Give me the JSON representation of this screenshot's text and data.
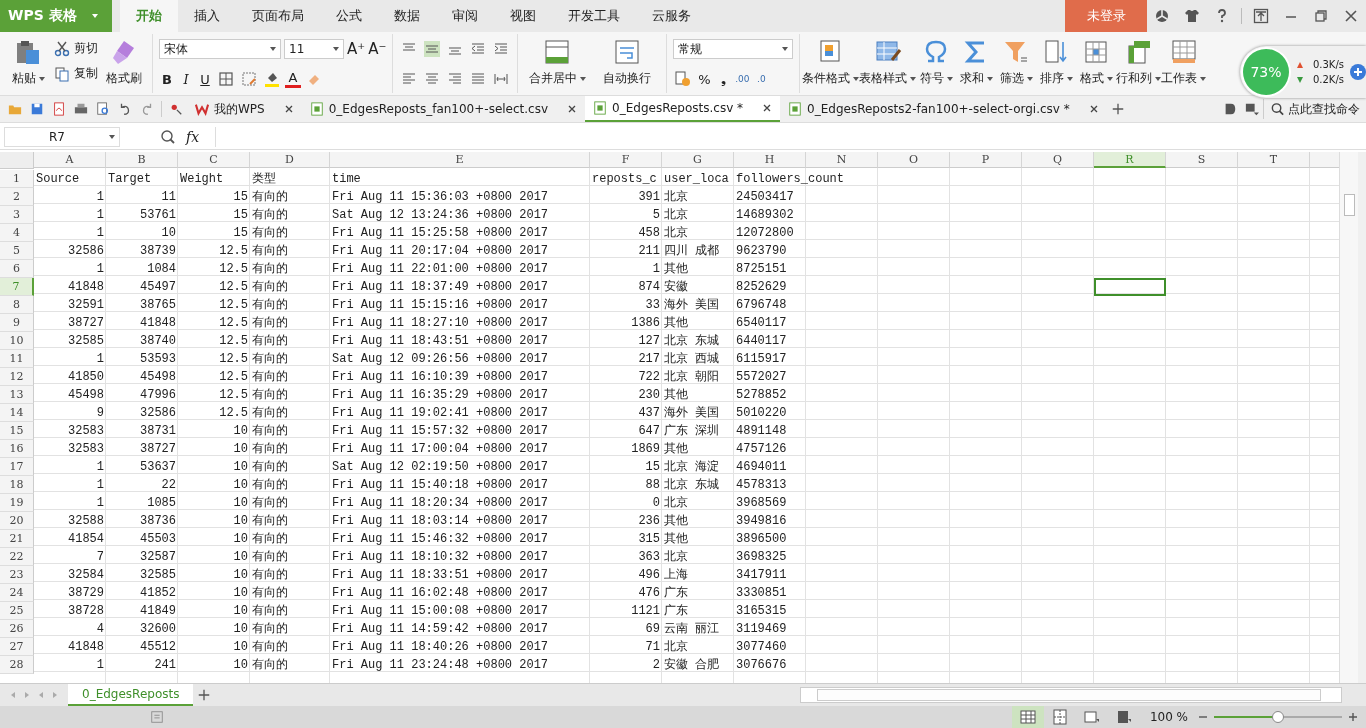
{
  "title_bar": {
    "app_button": "WPS 表格",
    "menu_tabs": [
      {
        "label": "开始",
        "selected": true
      },
      {
        "label": "插入",
        "selected": false
      },
      {
        "label": "页面布局",
        "selected": false
      },
      {
        "label": "公式",
        "selected": false
      },
      {
        "label": "数据",
        "selected": false
      },
      {
        "label": "审阅",
        "selected": false
      },
      {
        "label": "视图",
        "selected": false
      },
      {
        "label": "开发工具",
        "selected": false
      },
      {
        "label": "云服务",
        "selected": false
      }
    ],
    "login": "未登录"
  },
  "ribbon": {
    "paste": "粘贴",
    "cut": "剪切",
    "copy": "复制",
    "format_painter": "格式刷",
    "font": "宋体",
    "font_size": "11",
    "size_buttons": [
      "A⁺",
      "A⁻"
    ],
    "style_buttons": [
      "B",
      "I",
      "U"
    ],
    "font_color": "A",
    "merge": "合并居中",
    "wrap": "自动换行",
    "number_format": "常规",
    "percent": "%",
    "comma": "❟",
    "decimals": [
      ".00",
      ".0"
    ],
    "big_buttons": [
      {
        "label": "条件格式",
        "kind": "condition"
      },
      {
        "label": "表格样式",
        "kind": "style"
      },
      {
        "label": "符号",
        "kind": "omega"
      },
      {
        "label": "求和",
        "kind": "sigma"
      },
      {
        "label": "筛选",
        "kind": "filter"
      },
      {
        "label": "排序",
        "kind": "sort"
      },
      {
        "label": "格式",
        "kind": "format"
      },
      {
        "label": "行和列",
        "kind": "rowcol"
      },
      {
        "label": "工作表",
        "kind": "sheet"
      }
    ]
  },
  "network_widget": {
    "percent": "73%",
    "upload": "0.3K/s",
    "download": "0.2K/s"
  },
  "doc_tabs": [
    {
      "label": "我的WPS",
      "kind": "home",
      "selected": false
    },
    {
      "label": "0_EdgesReposts_fan100+-select.csv",
      "kind": "file",
      "selected": false
    },
    {
      "label": "0_EdgesReposts.csv *",
      "kind": "file",
      "selected": true
    },
    {
      "label": "0_EdgesReposts2-fan100+-select-orgi.csv *",
      "kind": "file",
      "selected": false
    }
  ],
  "command_search": {
    "placeholder": "点此查找命令"
  },
  "formula_bar": {
    "name_box": "R7",
    "fx": "fx"
  },
  "sheet": {
    "columns": [
      {
        "letter": "A",
        "selected": false
      },
      {
        "letter": "B",
        "selected": false
      },
      {
        "letter": "C",
        "selected": false
      },
      {
        "letter": "D",
        "selected": false
      },
      {
        "letter": "E",
        "selected": false
      },
      {
        "letter": "F",
        "selected": false
      },
      {
        "letter": "G",
        "selected": false
      },
      {
        "letter": "H",
        "selected": false
      },
      {
        "letter": "N",
        "selected": false
      },
      {
        "letter": "O",
        "selected": false
      },
      {
        "letter": "P",
        "selected": false
      },
      {
        "letter": "Q",
        "selected": false
      },
      {
        "letter": "R",
        "selected": true
      },
      {
        "letter": "S",
        "selected": false
      },
      {
        "letter": "T",
        "selected": false
      }
    ],
    "rows": [
      {
        "number": "1",
        "kind": "header",
        "selected": false,
        "cells": [
          "Source",
          "Target",
          "Weight",
          "类型",
          "time",
          "reposts_c",
          "user_loca",
          "followers_count"
        ]
      },
      {
        "number": "2",
        "kind": "data",
        "selected": false,
        "cells": [
          "1",
          "11",
          "15",
          "有向的",
          "Fri Aug 11 15:36:03 +0800 2017",
          "391",
          "北京",
          "24503417"
        ]
      },
      {
        "number": "3",
        "kind": "data",
        "selected": false,
        "cells": [
          "1",
          "53761",
          "15",
          "有向的",
          "Sat Aug 12 13:24:36 +0800 2017",
          "5",
          "北京",
          "14689302"
        ]
      },
      {
        "number": "4",
        "kind": "data",
        "selected": false,
        "cells": [
          "1",
          "10",
          "15",
          "有向的",
          "Fri Aug 11 15:25:58 +0800 2017",
          "458",
          "北京",
          "12072800"
        ]
      },
      {
        "number": "5",
        "kind": "data",
        "selected": false,
        "cells": [
          "32586",
          "38739",
          "12.5",
          "有向的",
          "Fri Aug 11 20:17:04 +0800 2017",
          "211",
          "四川 成都",
          "9623790"
        ]
      },
      {
        "number": "6",
        "kind": "data",
        "selected": false,
        "cells": [
          "1",
          "1084",
          "12.5",
          "有向的",
          "Fri Aug 11 22:01:00 +0800 2017",
          "1",
          "其他",
          "8725151"
        ]
      },
      {
        "number": "7",
        "kind": "data",
        "selected": true,
        "cells": [
          "41848",
          "45497",
          "12.5",
          "有向的",
          "Fri Aug 11 18:37:49 +0800 2017",
          "874",
          "安徽",
          "8252629"
        ]
      },
      {
        "number": "8",
        "kind": "data",
        "selected": false,
        "cells": [
          "32591",
          "38765",
          "12.5",
          "有向的",
          "Fri Aug 11 15:15:16 +0800 2017",
          "33",
          "海外 美国",
          "6796748"
        ]
      },
      {
        "number": "9",
        "kind": "data",
        "selected": false,
        "cells": [
          "38727",
          "41848",
          "12.5",
          "有向的",
          "Fri Aug 11 18:27:10 +0800 2017",
          "1386",
          "其他",
          "6540117"
        ]
      },
      {
        "number": "10",
        "kind": "data",
        "selected": false,
        "cells": [
          "32585",
          "38740",
          "12.5",
          "有向的",
          "Fri Aug 11 18:43:51 +0800 2017",
          "127",
          "北京 东城",
          "6440117"
        ]
      },
      {
        "number": "11",
        "kind": "data",
        "selected": false,
        "cells": [
          "1",
          "53593",
          "12.5",
          "有向的",
          "Sat Aug 12 09:26:56 +0800 2017",
          "217",
          "北京 西城",
          "6115917"
        ]
      },
      {
        "number": "12",
        "kind": "data",
        "selected": false,
        "cells": [
          "41850",
          "45498",
          "12.5",
          "有向的",
          "Fri Aug 11 16:10:39 +0800 2017",
          "722",
          "北京 朝阳",
          "5572027"
        ]
      },
      {
        "number": "13",
        "kind": "data",
        "selected": false,
        "cells": [
          "45498",
          "47996",
          "12.5",
          "有向的",
          "Fri Aug 11 16:35:29 +0800 2017",
          "230",
          "其他",
          "5278852"
        ]
      },
      {
        "number": "14",
        "kind": "data",
        "selected": false,
        "cells": [
          "9",
          "32586",
          "12.5",
          "有向的",
          "Fri Aug 11 19:02:41 +0800 2017",
          "437",
          "海外 美国",
          "5010220"
        ]
      },
      {
        "number": "15",
        "kind": "data",
        "selected": false,
        "cells": [
          "32583",
          "38731",
          "10",
          "有向的",
          "Fri Aug 11 15:57:32 +0800 2017",
          "647",
          "广东 深圳",
          "4891148"
        ]
      },
      {
        "number": "16",
        "kind": "data",
        "selected": false,
        "cells": [
          "32583",
          "38727",
          "10",
          "有向的",
          "Fri Aug 11 17:00:04 +0800 2017",
          "1869",
          "其他",
          "4757126"
        ]
      },
      {
        "number": "17",
        "kind": "data",
        "selected": false,
        "cells": [
          "1",
          "53637",
          "10",
          "有向的",
          "Sat Aug 12 02:19:50 +0800 2017",
          "15",
          "北京 海淀",
          "4694011"
        ]
      },
      {
        "number": "18",
        "kind": "data",
        "selected": false,
        "cells": [
          "1",
          "22",
          "10",
          "有向的",
          "Fri Aug 11 15:40:18 +0800 2017",
          "88",
          "北京 东城",
          "4578313"
        ]
      },
      {
        "number": "19",
        "kind": "data",
        "selected": false,
        "cells": [
          "1",
          "1085",
          "10",
          "有向的",
          "Fri Aug 11 18:20:34 +0800 2017",
          "0",
          "北京",
          "3968569"
        ]
      },
      {
        "number": "20",
        "kind": "data",
        "selected": false,
        "cells": [
          "32588",
          "38736",
          "10",
          "有向的",
          "Fri Aug 11 18:03:14 +0800 2017",
          "236",
          "其他",
          "3949816"
        ]
      },
      {
        "number": "21",
        "kind": "data",
        "selected": false,
        "cells": [
          "41854",
          "45503",
          "10",
          "有向的",
          "Fri Aug 11 15:46:32 +0800 2017",
          "315",
          "其他",
          "3896500"
        ]
      },
      {
        "number": "22",
        "kind": "data",
        "selected": false,
        "cells": [
          "7",
          "32587",
          "10",
          "有向的",
          "Fri Aug 11 18:10:32 +0800 2017",
          "363",
          "北京",
          "3698325"
        ]
      },
      {
        "number": "23",
        "kind": "data",
        "selected": false,
        "cells": [
          "32584",
          "32585",
          "10",
          "有向的",
          "Fri Aug 11 18:33:51 +0800 2017",
          "496",
          "上海",
          "3417911"
        ]
      },
      {
        "number": "24",
        "kind": "data",
        "selected": false,
        "cells": [
          "38729",
          "41852",
          "10",
          "有向的",
          "Fri Aug 11 16:02:48 +0800 2017",
          "476",
          "广东",
          "3330851"
        ]
      },
      {
        "number": "25",
        "kind": "data",
        "selected": false,
        "cells": [
          "38728",
          "41849",
          "10",
          "有向的",
          "Fri Aug 11 15:00:08 +0800 2017",
          "1121",
          "广东",
          "3165315"
        ]
      },
      {
        "number": "26",
        "kind": "data",
        "selected": false,
        "cells": [
          "4",
          "32600",
          "10",
          "有向的",
          "Fri Aug 11 14:59:42 +0800 2017",
          "69",
          "云南 丽江",
          "3119469"
        ]
      },
      {
        "number": "27",
        "kind": "data",
        "selected": false,
        "cells": [
          "41848",
          "45512",
          "10",
          "有向的",
          "Fri Aug 11 18:40:26 +0800 2017",
          "71",
          "北京",
          "3077460"
        ]
      },
      {
        "number": "28",
        "kind": "data",
        "selected": false,
        "cells": [
          "1",
          "241",
          "10",
          "有向的",
          "Fri Aug 11 23:24:48 +0800 2017",
          "2",
          "安徽 合肥",
          "3076676"
        ]
      }
    ]
  },
  "sheet_tabs": [
    {
      "label": "0_EdgesReposts",
      "selected": true
    }
  ],
  "status_bar": {
    "zoom": "100 %",
    "level": 0.5
  }
}
